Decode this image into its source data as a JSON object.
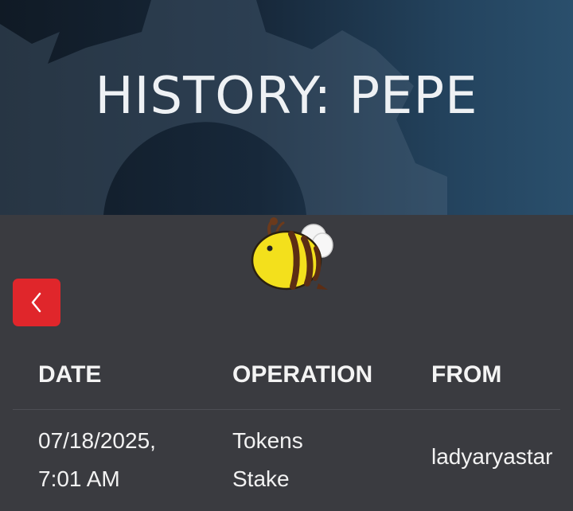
{
  "header": {
    "title": "HISTORY: PEPE"
  },
  "back_button": {
    "icon": "chevron-left-icon",
    "color": "#e0262b"
  },
  "mascot": {
    "icon": "bee-icon"
  },
  "table": {
    "columns": [
      "DATE",
      "OPERATION",
      "FROM"
    ],
    "rows": [
      {
        "date_line1": "07/18/2025,",
        "date_line2": "7:01 AM",
        "operation_line1": "Tokens",
        "operation_line2": "Stake",
        "from": "ladyaryastar"
      }
    ]
  }
}
